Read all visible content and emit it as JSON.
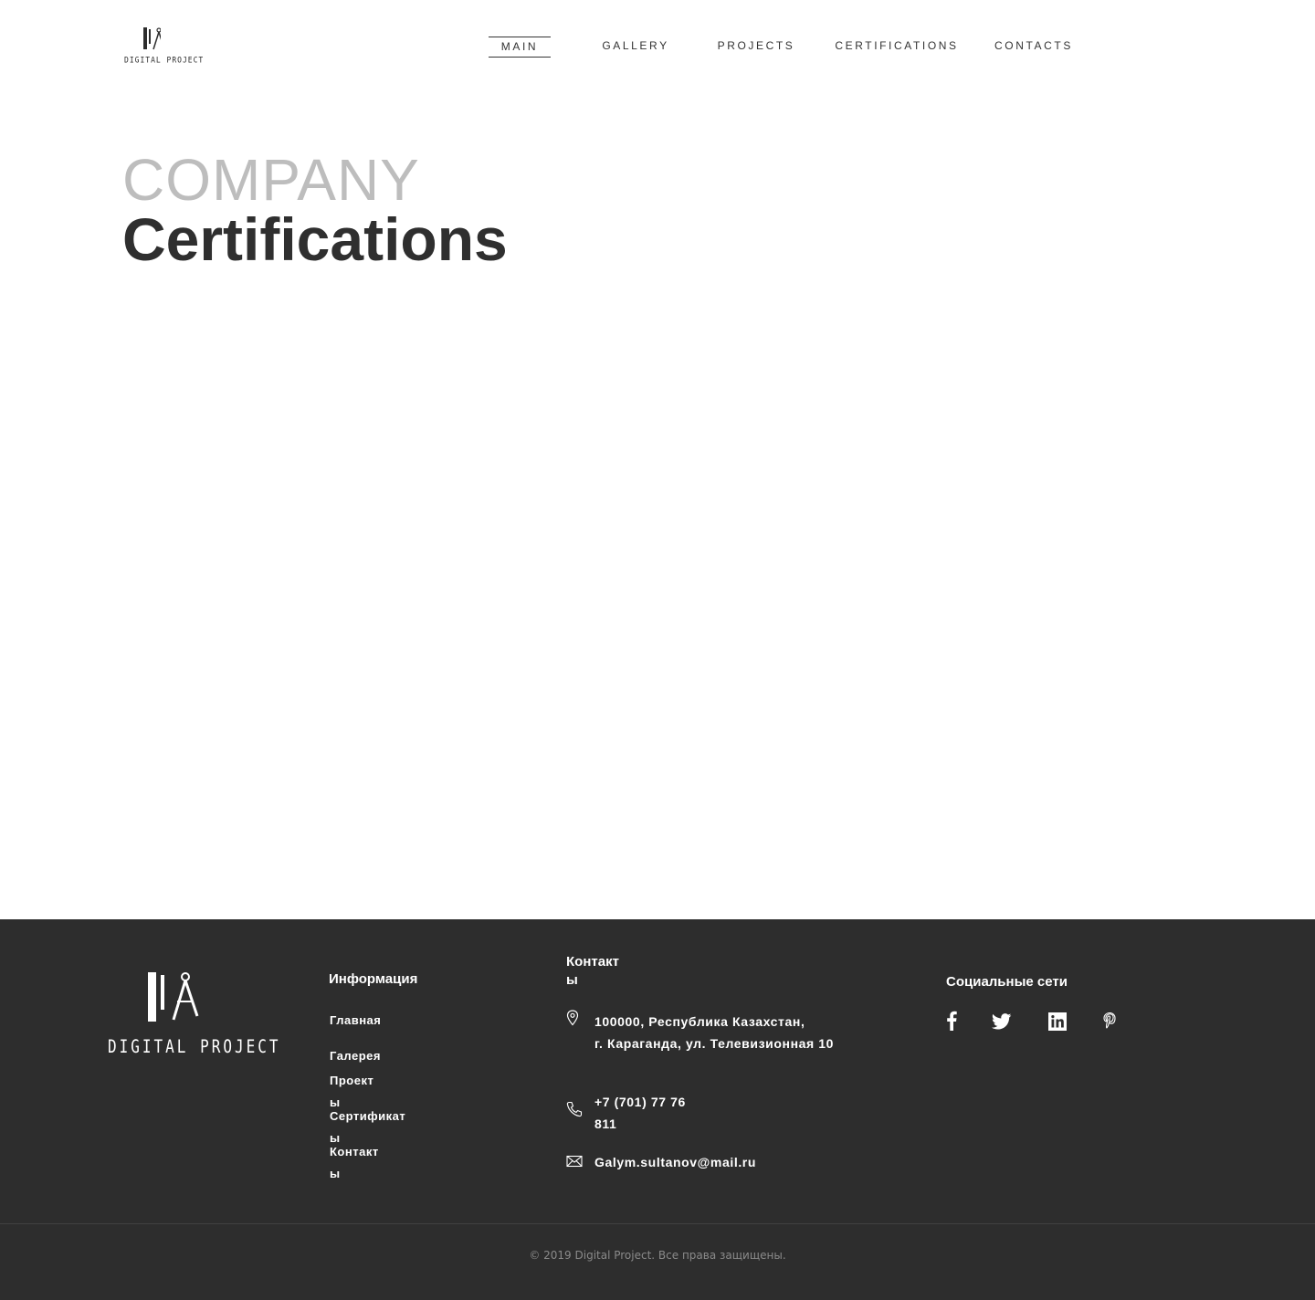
{
  "header": {
    "logo_text": "DIGITAL PROJECT",
    "nav": [
      {
        "label": "MAIN",
        "active": true
      },
      {
        "label": "GALLERY",
        "active": false
      },
      {
        "label": "PROJECTS",
        "active": false
      },
      {
        "label": "CERTIFICATIONS",
        "active": false
      },
      {
        "label": "CONTACTS",
        "active": false
      }
    ]
  },
  "hero": {
    "subtitle": "COMPANY",
    "title": "Certifications"
  },
  "footer": {
    "logo_text": "DIGITAL PROJECT",
    "info_heading": "Информация",
    "links": [
      "Главная",
      "Галерея",
      "Проект\nы",
      "Сертификат\nы",
      "Контакт\nы"
    ],
    "contacts_heading": "Контакт\nы",
    "address_line1": "100000, Республика  Казахстан,",
    "address_line2": "г. Караганда, ул. Телевизионная 10",
    "phone_line1": "+7 (701) 77 76",
    "phone_line2": "811",
    "email": "Galym.sultanov@mail.ru",
    "social_heading": "Социальные сети",
    "social_icons": [
      "facebook-icon",
      "twitter-icon",
      "linkedin-icon",
      "pinterest-icon"
    ],
    "copyright": "© 2019 Digital Project. Все права защищены."
  },
  "colors": {
    "footer_bg": "#2d2d2d",
    "text_dark": "#2f2f2f",
    "text_light": "#bdbdbd"
  }
}
